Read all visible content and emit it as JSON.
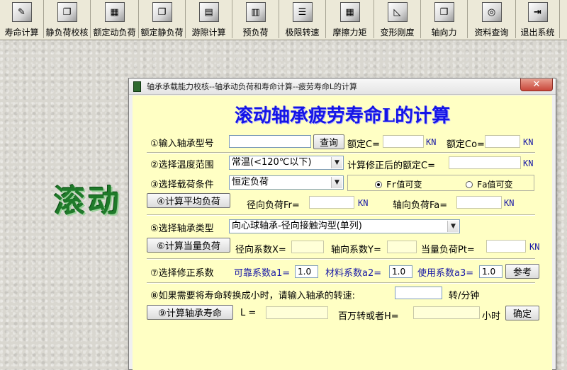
{
  "toolbar": [
    {
      "label": "寿命计算",
      "icon": "edit-icon",
      "glyph": "✎"
    },
    {
      "label": "静负荷校核",
      "icon": "copy-icon",
      "glyph": "❐"
    },
    {
      "label": "额定动负荷",
      "icon": "calculator-icon",
      "glyph": "▦"
    },
    {
      "label": "额定静负荷",
      "icon": "copy-icon",
      "glyph": "❐"
    },
    {
      "label": "游隙计算",
      "icon": "document-icon",
      "glyph": "▤"
    },
    {
      "label": "预负荷",
      "icon": "grid-icon",
      "glyph": "▥"
    },
    {
      "label": "极限转速",
      "icon": "list-icon",
      "glyph": "☰"
    },
    {
      "label": "摩擦力矩",
      "icon": "grid-icon",
      "glyph": "▦"
    },
    {
      "label": "变形刚度",
      "icon": "ruler-icon",
      "glyph": "◺"
    },
    {
      "label": "轴向力",
      "icon": "window-icon",
      "glyph": "❒"
    },
    {
      "label": "资料查询",
      "icon": "gauge-icon",
      "glyph": "◎"
    },
    {
      "label": "退出系统",
      "icon": "exit-icon",
      "glyph": "⇥"
    }
  ],
  "background_title": "滚动",
  "dialog": {
    "title": "轴承承载能力校核--轴承动负荷和寿命计算--疲劳寿命L的计算",
    "close_glyph": "✕",
    "heading": "滚动轴承疲劳寿命L的计算",
    "row1": {
      "label": "①输入轴承型号",
      "model_value": "",
      "query_button": "查询",
      "rated_c_label": "额定C=",
      "rated_c_value": "",
      "unit1": "KN",
      "rated_co_label": "额定Co=",
      "rated_co_value": "",
      "unit2": "KN"
    },
    "row2": {
      "label": "②选择温度范围",
      "temp_selected": "常温(<120℃以下)",
      "corrected_label": "计算修正后的额定C=",
      "corrected_value": "",
      "unit": "KN"
    },
    "row3": {
      "label": "③选择载荷条件",
      "load_selected": "恒定负荷",
      "radio_fr": "Fr值可变",
      "radio_fa": "Fa值可变",
      "radio_selected": "Fr"
    },
    "row4": {
      "button": "④计算平均负荷",
      "fr_label": "径向负荷Fr=",
      "fr_value": "",
      "unit1": "KN",
      "fa_label": "轴向负荷Fa=",
      "fa_value": "",
      "unit2": "KN"
    },
    "row5": {
      "label": "⑤选择轴承类型",
      "type_selected": "向心球轴承-径向接触沟型(单列)"
    },
    "row6": {
      "button": "⑥计算当量负荷",
      "x_label": "径向系数X=",
      "x_value": "",
      "y_label": "轴向系数Y=",
      "y_value": "",
      "pt_label": "当量负荷Pt=",
      "pt_value": "",
      "unit": "KN"
    },
    "row7": {
      "label": "⑦选择修正系数",
      "a1_label": "可靠系数a1=",
      "a1_value": "1.0",
      "a2_label": "材料系数a2=",
      "a2_value": "1.0",
      "a3_label": "使用系数a3=",
      "a3_value": "1.0",
      "ref_button": "参考"
    },
    "row8": {
      "label": "⑧如果需要将寿命转换成小时，请输入轴承的转速:",
      "speed_value": "",
      "unit": "转/分钟"
    },
    "row9": {
      "button": "⑨计算轴承寿命",
      "l_label": "L =",
      "l_value": "",
      "h_label": "百万转或者H=",
      "h_value": "",
      "h_unit": "小时",
      "ok_button": "确定"
    }
  }
}
